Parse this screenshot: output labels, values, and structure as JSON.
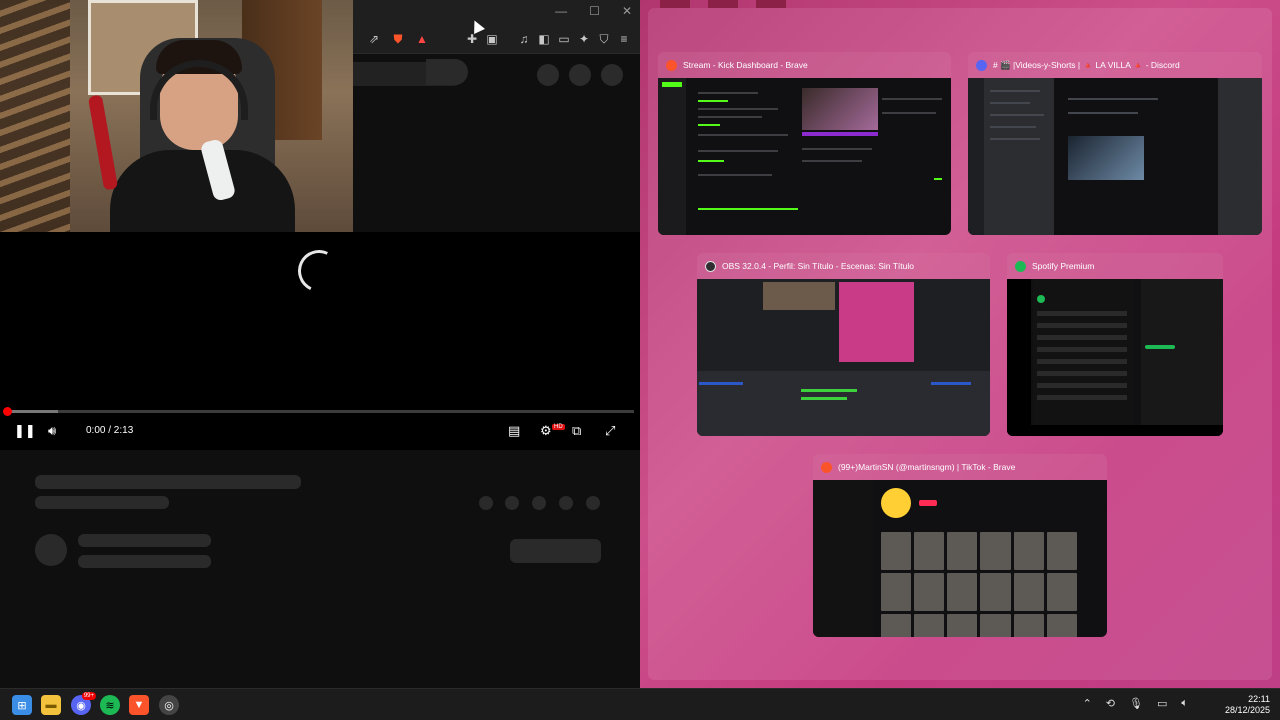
{
  "player": {
    "time": "0:00 / 2:13",
    "progress_fraction": 0.0,
    "hd_badge": "HD",
    "play_icon": "pause-icon",
    "volume_icon": "volume-icon",
    "captions_icon": "captions-icon",
    "settings_icon": "settings-gear-icon",
    "miniplayer_icon": "miniplayer-icon",
    "fullscreen_icon": "fullscreen-icon"
  },
  "window": {
    "minimize": "—",
    "maximize": "☐",
    "close": "✕"
  },
  "toolbar": {
    "icons": [
      "share-icon",
      "brave-shield-icon",
      "brave-rewards-icon",
      "extensions-icon",
      "tab-search-icon",
      "media-icon",
      "sidebar-icon",
      "wallet-icon",
      "leo-ai-icon",
      "vpn-icon",
      "menu-icon"
    ]
  },
  "taskview": {
    "windows": [
      {
        "title": "Stream - Kick Dashboard - Brave",
        "app": "brave-icon",
        "color": "#fb542b"
      },
      {
        "title": "# 🎬 |Videos-y-Shorts | 🔺 LA VILLA 🔺 - Discord",
        "app": "discord-icon",
        "color": "#5865f2"
      },
      {
        "title": "OBS 32.0.4 - Perfil: Sin Título - Escenas: Sin Título",
        "app": "obs-icon",
        "color": "#302e31"
      },
      {
        "title": "Spotify Premium",
        "app": "spotify-icon",
        "color": "#1db954"
      },
      {
        "title": "(99+)MartinSN (@martinsngm) | TikTok - Brave",
        "app": "brave-icon",
        "color": "#fb542b"
      }
    ]
  },
  "taskbar": {
    "apps": [
      {
        "name": "windows-start-icon",
        "glyph": "⊞",
        "color": "#3a8ee6"
      },
      {
        "name": "file-explorer-icon",
        "glyph": "▬",
        "color": "#f3c33d"
      },
      {
        "name": "discord-icon",
        "glyph": "◉",
        "color": "#5865f2",
        "badge": "99+"
      },
      {
        "name": "spotify-icon",
        "glyph": "≋",
        "color": "#1db954"
      },
      {
        "name": "brave-icon",
        "glyph": "▼",
        "color": "#fb542b"
      },
      {
        "name": "obs-icon",
        "glyph": "◎",
        "color": "#444"
      }
    ],
    "tray": [
      "chevron-up-icon",
      "wifi-sync-icon",
      "microphone-icon",
      "network-icon",
      "volume-icon"
    ],
    "time": "22:11",
    "date": "28/12/2025"
  }
}
